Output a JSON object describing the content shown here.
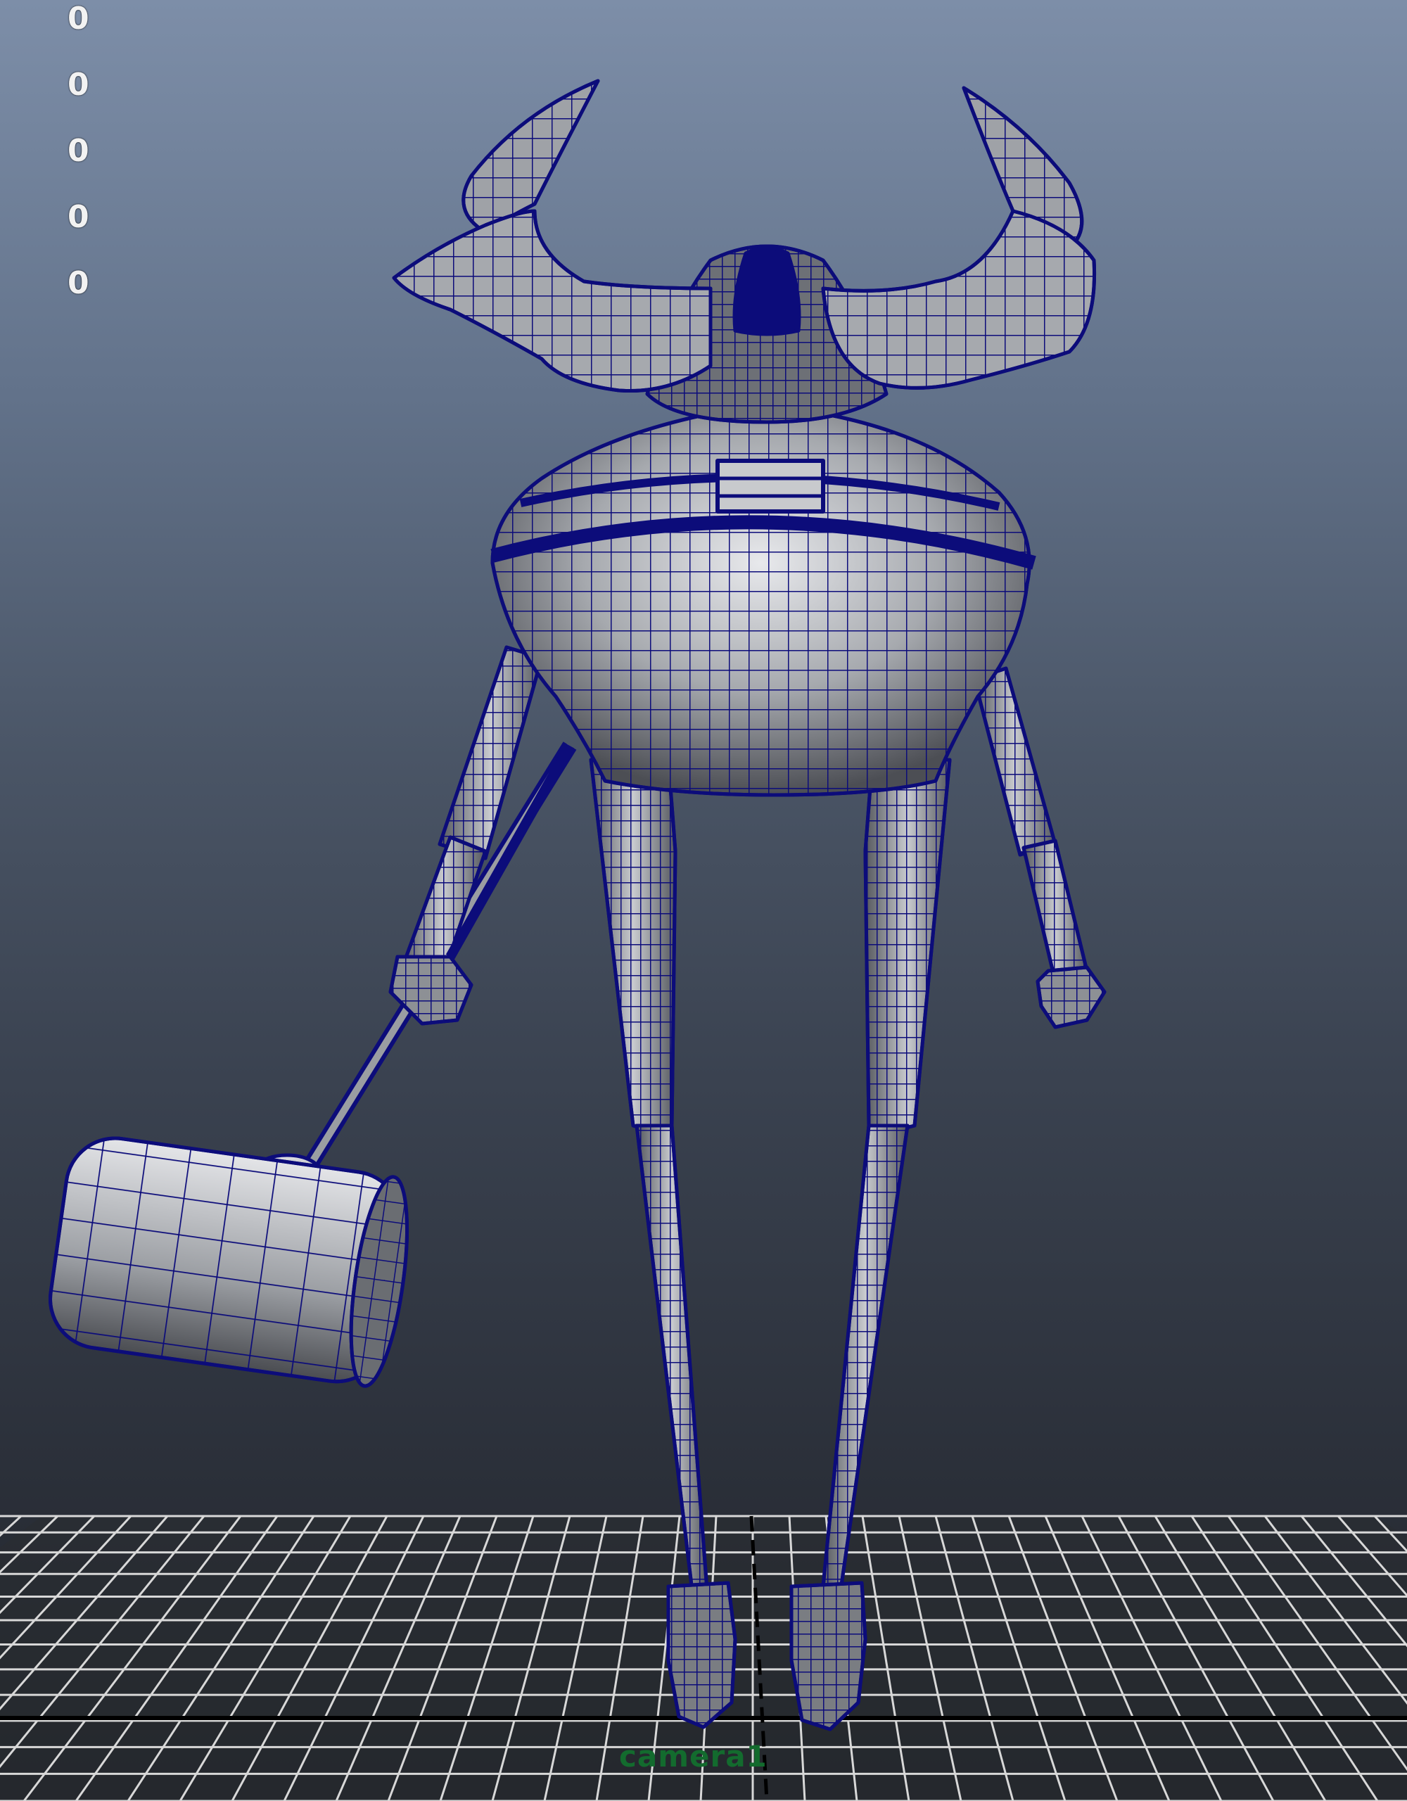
{
  "viewport": {
    "hud_values": [
      "0",
      "0",
      "0",
      "0",
      "0"
    ],
    "camera_label": "camera1"
  },
  "colors": {
    "background_top": "#7d8ea8",
    "background_bottom": "#1f2228",
    "wireframe": "#0c0c7a",
    "mesh_shade": "#a0a4aa",
    "grid": "#d8d8d8",
    "axis": "#000000",
    "camera_label": "#136b2e"
  },
  "model": {
    "parts": [
      "horns-icon",
      "head-icon",
      "body-icon",
      "arms-icon",
      "legs-icon",
      "feet-icon",
      "hammer-icon"
    ]
  }
}
